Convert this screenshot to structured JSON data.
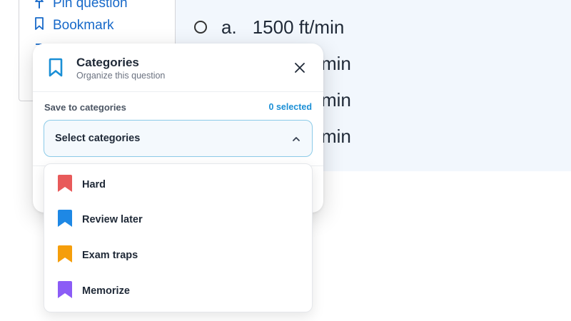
{
  "side_menu": {
    "items": [
      {
        "label": "Pin question",
        "icon": "pin-icon"
      },
      {
        "label": "Bookmark",
        "icon": "bookmark-icon"
      }
    ]
  },
  "question": {
    "options": [
      {
        "letter": "a.",
        "text": "1500 ft/min"
      },
      {
        "letter": "",
        "text": "min"
      },
      {
        "letter": "",
        "text": "min"
      },
      {
        "letter": "",
        "text": "min"
      }
    ]
  },
  "modal": {
    "title": "Categories",
    "subtitle": "Organize this question",
    "icon": "bookmark-icon",
    "accent_color": "#1a8fd6",
    "save_label": "Save to categories",
    "selected_count": "0 selected",
    "select_placeholder": "Select categories",
    "categories": [
      {
        "label": "Hard",
        "color": "#e85a5a"
      },
      {
        "label": "Review later",
        "color": "#1e88e5"
      },
      {
        "label": "Exam traps",
        "color": "#f59e0b"
      },
      {
        "label": "Memorize",
        "color": "#8b5cf6"
      }
    ]
  }
}
